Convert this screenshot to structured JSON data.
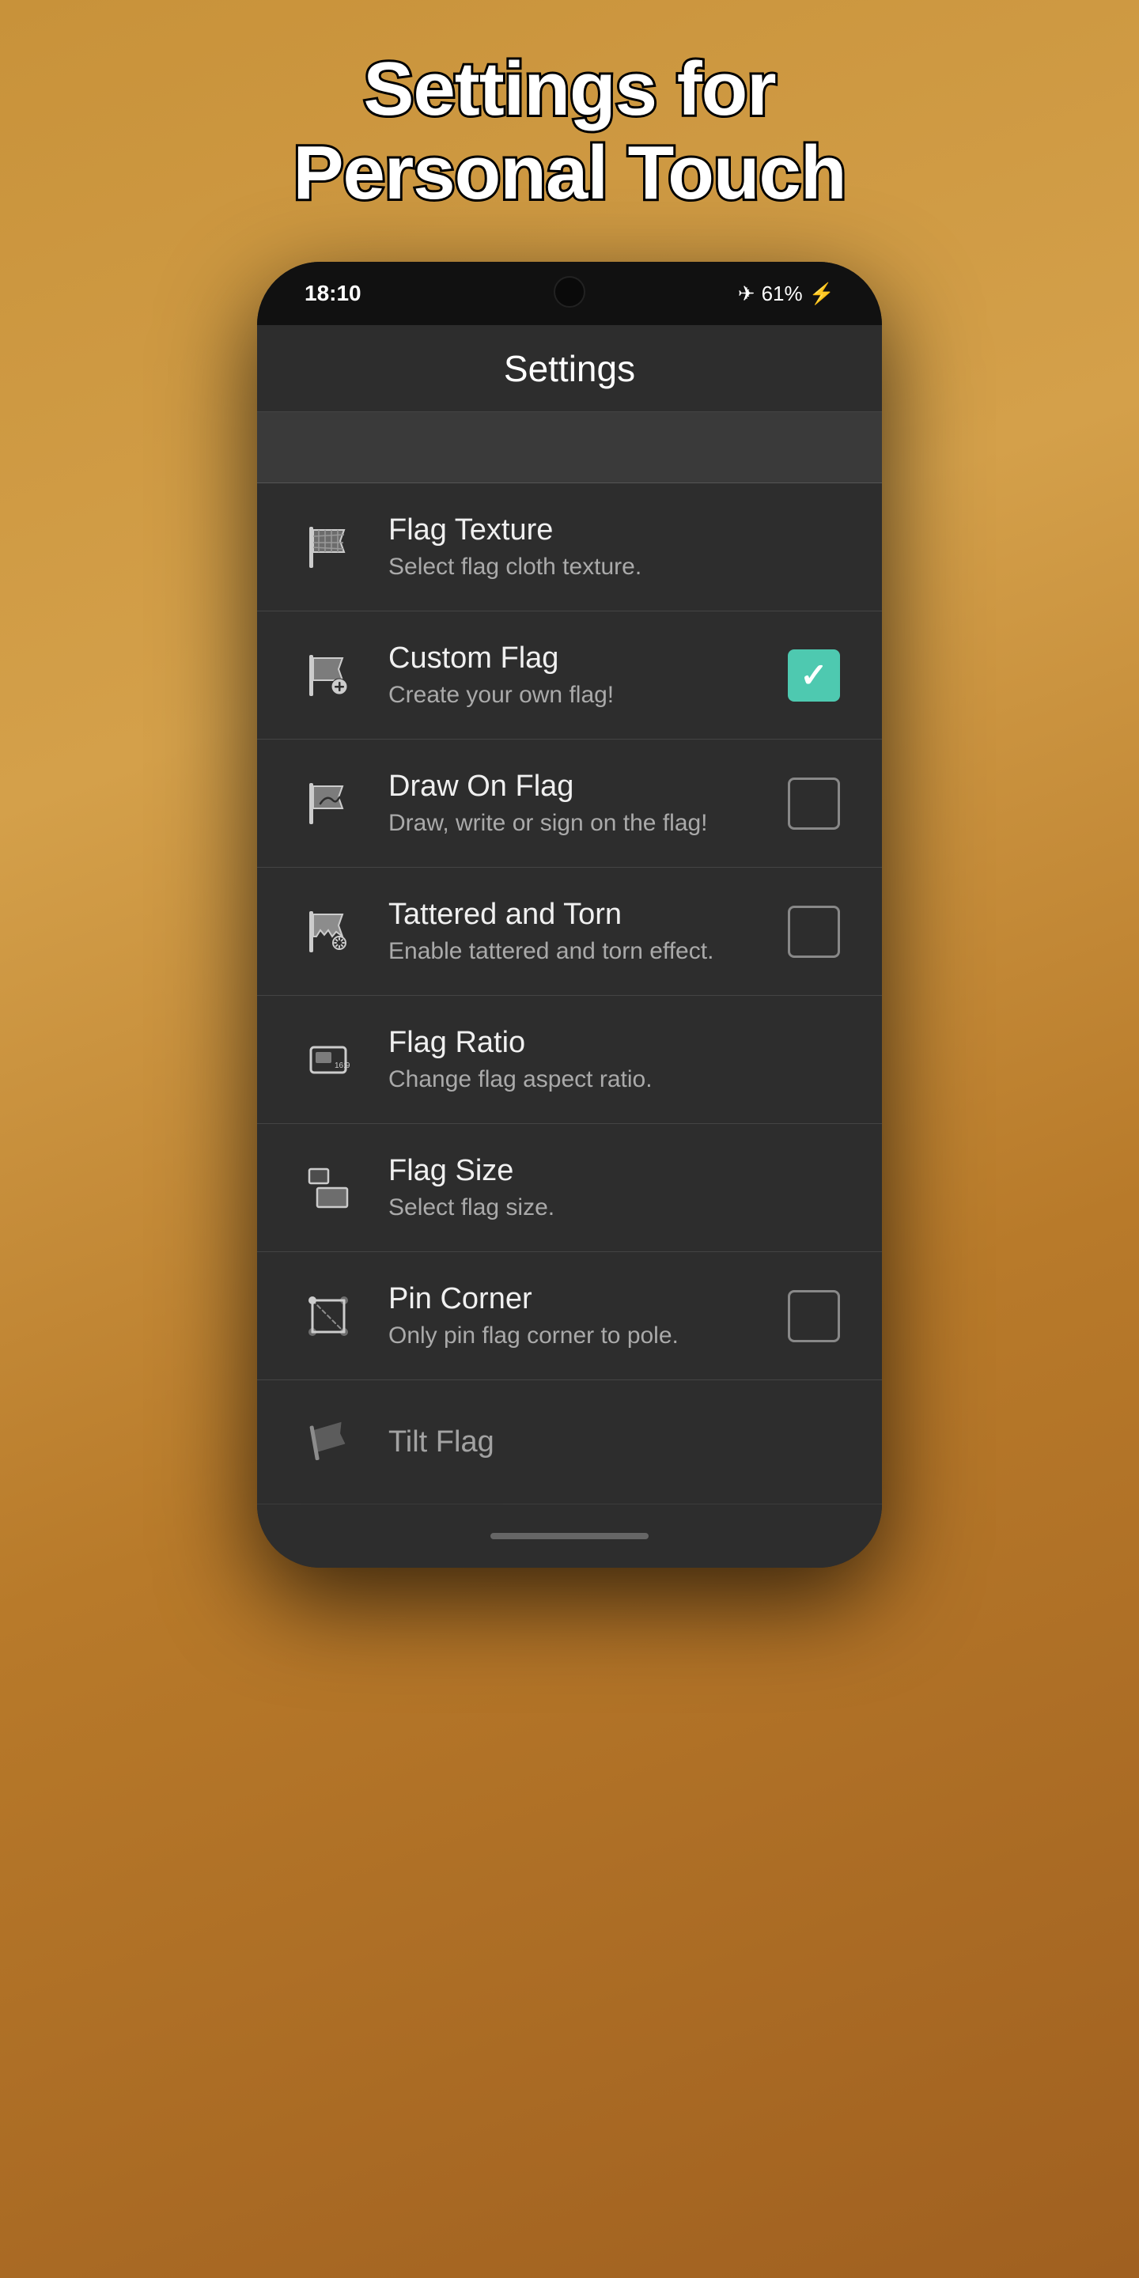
{
  "page": {
    "title_line1": "Settings for",
    "title_line2": "Personal Touch"
  },
  "status_bar": {
    "time": "18:10",
    "battery": "61%",
    "battery_icon": "⚡",
    "airplane_icon": "✈"
  },
  "app_bar": {
    "title": "Settings"
  },
  "settings": {
    "items": [
      {
        "id": "flag-texture",
        "title": "Flag Texture",
        "subtitle": "Select flag cloth texture.",
        "has_checkbox": false,
        "checked": false,
        "icon": "flag-texture-icon"
      },
      {
        "id": "custom-flag",
        "title": "Custom Flag",
        "subtitle": "Create your own flag!",
        "has_checkbox": true,
        "checked": true,
        "icon": "custom-flag-icon"
      },
      {
        "id": "draw-on-flag",
        "title": "Draw On Flag",
        "subtitle": "Draw, write or sign on the flag!",
        "has_checkbox": true,
        "checked": false,
        "icon": "draw-flag-icon"
      },
      {
        "id": "tattered-and-torn",
        "title": "Tattered and Torn",
        "subtitle": "Enable tattered and torn effect.",
        "has_checkbox": true,
        "checked": false,
        "icon": "tattered-flag-icon"
      },
      {
        "id": "flag-ratio",
        "title": "Flag Ratio",
        "subtitle": "Change flag aspect ratio.",
        "has_checkbox": false,
        "checked": false,
        "icon": "flag-ratio-icon"
      },
      {
        "id": "flag-size",
        "title": "Flag Size",
        "subtitle": "Select flag size.",
        "has_checkbox": false,
        "checked": false,
        "icon": "flag-size-icon"
      },
      {
        "id": "pin-corner",
        "title": "Pin Corner",
        "subtitle": "Only pin flag corner to pole.",
        "has_checkbox": true,
        "checked": false,
        "icon": "pin-corner-icon"
      },
      {
        "id": "tilt-flag",
        "title": "Tilt Flag",
        "subtitle": "",
        "has_checkbox": false,
        "checked": false,
        "icon": "tilt-flag-icon"
      }
    ]
  }
}
